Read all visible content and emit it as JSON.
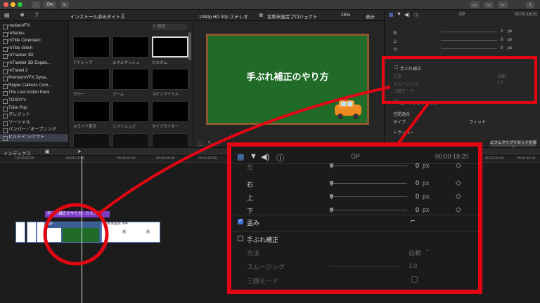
{
  "titlebar": {
    "btn_label": "Ow"
  },
  "browser": {
    "filter_label": "インストール済みタイトル",
    "search_placeholder": "検索",
    "thumbs": [
      "アドシップ",
      "エネルギッシュ",
      "カスタム",
      "グロー",
      "ズーム",
      "スピンサイクル",
      "スライド表示",
      "ソフトエッジ",
      "タイプライター"
    ]
  },
  "libraries": {
    "items": [
      "motionVFX",
      "mSeries",
      "mTitle Cinematic",
      "mTitle Glitch",
      "mTracker 3D",
      "mTracker 3D Expan...",
      "mTravel 2",
      "PremiumVFX Dyna...",
      "Ripple Callouts Com...",
      "The Luut Action Pack",
      "TOSSY's",
      "Tube Pop",
      "クレジット",
      "ソーシャル",
      "バンパー／オープニング",
      "ビルドイン/アウト"
    ]
  },
  "viewer": {
    "format": "1080p HD 30p ステレオ",
    "project": "名称未設定プロジェクト",
    "zoom": "25%",
    "view_label": "表示",
    "title_text": "手ぶれ補正のやり方"
  },
  "inspector": {
    "clip_name": "OP",
    "timecode": "00:00:18:20",
    "rows": [
      "右",
      "上",
      "下"
    ],
    "value": "0",
    "unit": "px",
    "stab_label": "手ぶれ補正",
    "method_label": "方法",
    "method_value": "自動",
    "smoothing_label": "スムージング",
    "smoothing_value": "1.0",
    "tripod_label": "三脚モード",
    "rolling_label": "ローリングシャッター",
    "spatial_label": "空間適合",
    "type_label": "タイプ",
    "type_value": "フィット",
    "tracker_label": "トラッカー",
    "save_preset": "エフェクトプリセットを保存"
  },
  "timeline": {
    "index_label": "インデックス",
    "timecodes": [
      "00:00:00:00",
      "00:00:15:00",
      "00:00:30:00",
      "00:00:45:00",
      "00:01:00:00",
      "00:02:30:00",
      "00:02:45:00"
    ],
    "connected_clip": "手ぶれ補正のやり方 - カスタム",
    "clip_op": "OP",
    "clip_project": "名称未設定 #04",
    "clip_markers": [
      "④",
      "④"
    ]
  },
  "zoom": {
    "clip_name": "OP",
    "timecode": "00:00:18:20",
    "rows": [
      "左",
      "右",
      "上",
      "下"
    ],
    "value": "0",
    "unit": "px",
    "distort_label": "歪み",
    "stab_label": "手ぶれ補正",
    "method_label": "方法",
    "method_value": "自動",
    "smoothing_label": "スムージング",
    "smoothing_value": "1.0",
    "tripod_label": "三脚モード"
  },
  "colors": {
    "highlight": "#e30613",
    "board": "#1f6b27",
    "accent": "#3b6fd6"
  }
}
